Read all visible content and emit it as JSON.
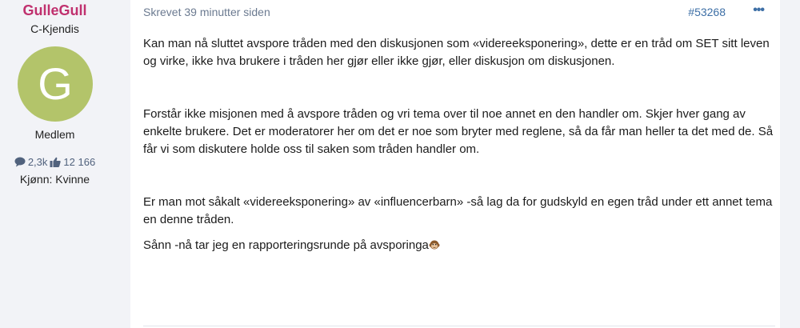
{
  "author": {
    "username": "GulleGull",
    "title": "C-Kjendis",
    "avatar_letter": "G",
    "avatar_color": "#b3c46a",
    "group": "Medlem",
    "posts_count": "2,3k",
    "reactions_count": "12 166",
    "gender": "Kjønn: Kvinne"
  },
  "post": {
    "time": "Skrevet 39 minutter siden",
    "number": "#53268",
    "more": "•••",
    "paragraphs": [
      "Kan man nå sluttet avspore tråden med den diskusjonen som «videreeksponering», dette er en tråd om SET sitt leven og virke, ikke hva brukere i tråden her gjør eller ikke gjør, eller diskusjon om diskusjonen.",
      "Forstår ikke misjonen med å avspore tråden og vri tema over til noe annet en den handler om. Skjer hver gang av enkelte brukere. Det er moderatorer her om det er noe som bryter med reglene, så da får man heller ta det med de. Så får vi som diskutere holde oss til saken som tråden handler om.",
      "Er man mot såkalt «videreeksponering» av «influencerbarn» -så lag da for gudskyld en egen tråd under ett annet tema en denne tråden.",
      "Sånn -nå tar jeg en rapporteringsrunde på avsporinga"
    ],
    "final_emoji": "monkey-face-icon"
  }
}
